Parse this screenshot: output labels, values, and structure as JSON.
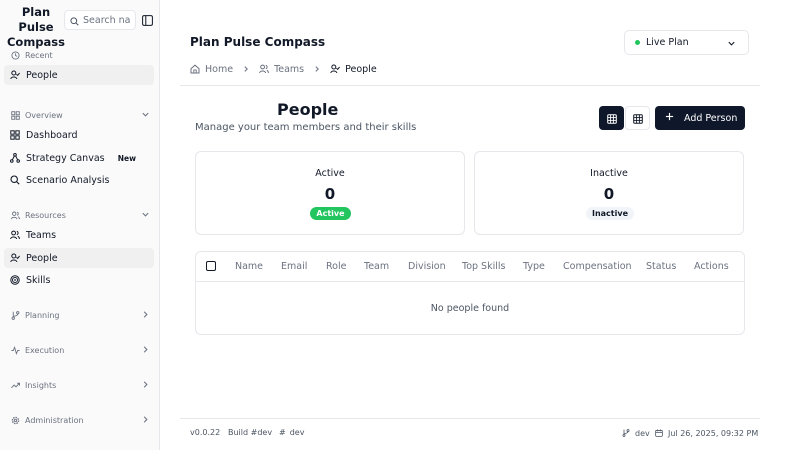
{
  "app": {
    "title": "Plan Pulse Compass"
  },
  "search": {
    "placeholder": "Search na"
  },
  "sidebar": {
    "recent": {
      "label": "Recent",
      "items": [
        {
          "label": "People",
          "icon": "user-check-icon"
        }
      ]
    },
    "sections": [
      {
        "label": "Overview",
        "icon": "layout-grid-icon",
        "expanded": true,
        "items": [
          {
            "label": "Dashboard",
            "icon": "layout-grid-icon"
          },
          {
            "label": "Strategy Canvas",
            "icon": "network-icon",
            "badge": "New"
          },
          {
            "label": "Scenario Analysis",
            "icon": "search-icon"
          }
        ]
      },
      {
        "label": "Resources",
        "icon": "users-icon",
        "expanded": true,
        "items": [
          {
            "label": "Teams",
            "icon": "users-icon"
          },
          {
            "label": "People",
            "icon": "user-check-icon",
            "active": true
          },
          {
            "label": "Skills",
            "icon": "target-icon"
          }
        ]
      },
      {
        "label": "Planning",
        "icon": "git-branch-icon",
        "expanded": false,
        "items": []
      },
      {
        "label": "Execution",
        "icon": "activity-icon",
        "expanded": false,
        "items": []
      },
      {
        "label": "Insights",
        "icon": "trending-up-icon",
        "expanded": false,
        "items": []
      },
      {
        "label": "Administration",
        "icon": "settings-icon",
        "expanded": false,
        "items": []
      }
    ]
  },
  "header": {
    "title": "Plan Pulse Compass",
    "plan_selector": {
      "value": "Live Plan",
      "status_color": "#22c55e"
    }
  },
  "breadcrumb": [
    {
      "label": "Home",
      "icon": "home-icon"
    },
    {
      "label": "Teams",
      "icon": "users-icon"
    },
    {
      "label": "People",
      "icon": "user-check-icon"
    }
  ],
  "page": {
    "title": "People",
    "subtitle": "Manage your team members and their skills",
    "add_button_label": "Add Person"
  },
  "stats": [
    {
      "title": "Active",
      "value": "0",
      "badge": "Active",
      "badge_color": "#22c55e"
    },
    {
      "title": "Inactive",
      "value": "0",
      "badge": "Inactive",
      "badge_color": "#f1f5f9"
    }
  ],
  "table": {
    "columns": [
      "Name",
      "Email",
      "Role",
      "Team",
      "Division",
      "Top Skills",
      "Type",
      "Compensation",
      "Status",
      "Actions"
    ],
    "empty_text": "No people found"
  },
  "footer": {
    "version": "v0.0.22",
    "build": "Build #dev",
    "hash": "dev",
    "branch": "dev",
    "timestamp": "Jul 26, 2025, 09:32 PM"
  },
  "colors": {
    "primary": "#0f172a",
    "success": "#22c55e",
    "border": "#e5e7eb",
    "muted_text": "#6b7280"
  }
}
